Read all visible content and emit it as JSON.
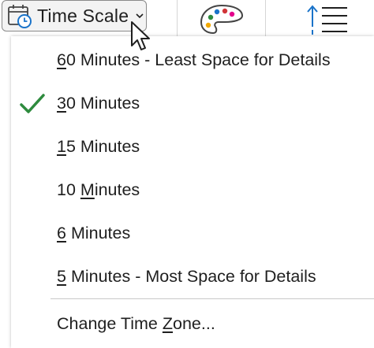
{
  "ribbon": {
    "time_scale_label": "Time Scale",
    "icons": {
      "calendar": "calendar-clock-icon",
      "chevron": "chevron-down-icon",
      "palette": "palette-icon",
      "line_spacing": "line-spacing-icon",
      "cursor": "mouse-pointer-icon"
    }
  },
  "menu": {
    "items": [
      {
        "accel": "6",
        "rest": "0 Minutes - Least Space for Details",
        "checked": false
      },
      {
        "accel": "3",
        "rest": "0 Minutes",
        "checked": true
      },
      {
        "accel": "1",
        "rest": "5 Minutes",
        "checked": false
      },
      {
        "pre": "10 ",
        "accel": "M",
        "rest": "inutes",
        "checked": false
      },
      {
        "accel": "6",
        "rest": " Minutes",
        "checked": false
      },
      {
        "accel": "5",
        "rest": " Minutes - Most Space for Details",
        "checked": false
      }
    ],
    "change_time_zone": {
      "pre": "Change Time ",
      "accel": "Z",
      "rest": "one..."
    }
  },
  "colors": {
    "check": "#2e8b3e",
    "accent_blue": "#1a73c9",
    "button_border": "#8a8a8a"
  }
}
